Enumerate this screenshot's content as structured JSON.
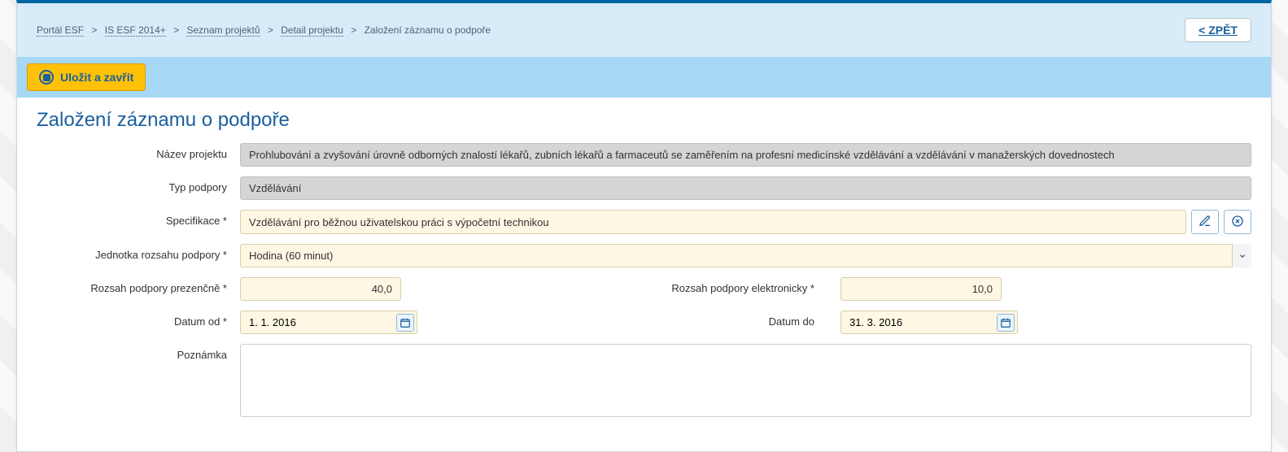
{
  "breadcrumb": {
    "items": [
      {
        "label": "Portál ESF"
      },
      {
        "label": "IS ESF 2014+"
      },
      {
        "label": "Seznam projektů"
      },
      {
        "label": "Detail projektu"
      }
    ],
    "current": "Založení záznamu o podpoře"
  },
  "buttons": {
    "back": "< ZPĚT",
    "save_close": "Uložit a zavřít"
  },
  "page_title": "Založení záznamu o podpoře",
  "form": {
    "nazev_projektu": {
      "label": "Název projektu",
      "value": "Prohlubování a zvyšování úrovně odborných znalostí lékařů, zubních lékařů a farmaceutů se zaměřením na profesní medicínské vzdělávání a vzdělávání v manažerských dovednostech"
    },
    "typ_podpory": {
      "label": "Typ podpory",
      "value": "Vzdělávání"
    },
    "specifikace": {
      "label": "Specifikace *",
      "value": "Vzdělávání pro běžnou uživatelskou práci s výpočetní technikou"
    },
    "jednotka_rozsahu": {
      "label": "Jednotka rozsahu podpory *",
      "value": "Hodina (60 minut)"
    },
    "rozsah_prezencne": {
      "label": "Rozsah podpory prezenčně *",
      "value": "40,0"
    },
    "rozsah_elektronicky": {
      "label": "Rozsah podpory elektronicky *",
      "value": "10,0"
    },
    "datum_od": {
      "label": "Datum od *",
      "value": "1. 1. 2016"
    },
    "datum_do": {
      "label": "Datum do",
      "value": "31. 3. 2016"
    },
    "poznamka": {
      "label": "Poznámka",
      "value": ""
    }
  }
}
